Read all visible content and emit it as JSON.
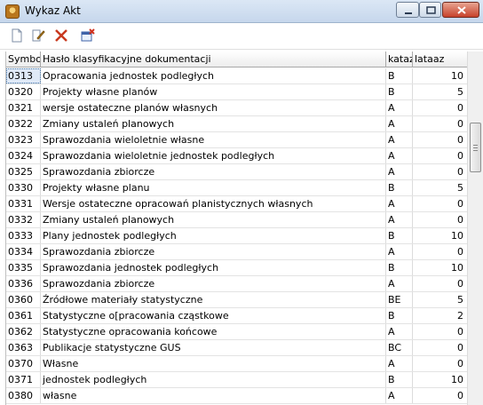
{
  "window": {
    "title": "Wykaz Akt"
  },
  "toolbar": {
    "buttons": [
      {
        "icon": "new-document-icon"
      },
      {
        "icon": "edit-document-icon"
      },
      {
        "icon": "delete-x-icon"
      },
      {
        "icon": "close-window-icon"
      }
    ]
  },
  "table": {
    "columns": {
      "symbol": "Symbol",
      "haslo": "Hasło klasyfikacyjne dokumentacji",
      "kataz": "kataz",
      "lataaz": "lataaz"
    },
    "rows": [
      {
        "symbol": "0313",
        "haslo": "Opracowania jednostek podległych",
        "kataz": "B",
        "lataaz": "10"
      },
      {
        "symbol": "0320",
        "haslo": "Projekty własne planów",
        "kataz": "B",
        "lataaz": "5"
      },
      {
        "symbol": "0321",
        "haslo": "wersje ostateczne planów własnych",
        "kataz": "A",
        "lataaz": "0"
      },
      {
        "symbol": "0322",
        "haslo": "Zmiany ustaleń planowych",
        "kataz": "A",
        "lataaz": "0"
      },
      {
        "symbol": "0323",
        "haslo": "Sprawozdania wieloletnie własne",
        "kataz": "A",
        "lataaz": "0"
      },
      {
        "symbol": "0324",
        "haslo": "Sprawozdania wieloletnie jednostek podległych",
        "kataz": "A",
        "lataaz": "0"
      },
      {
        "symbol": "0325",
        "haslo": "Sprawozdania zbiorcze",
        "kataz": "A",
        "lataaz": "0"
      },
      {
        "symbol": "0330",
        "haslo": "Projekty własne planu",
        "kataz": "B",
        "lataaz": "5"
      },
      {
        "symbol": "0331",
        "haslo": "Wersje ostateczne opracowań planistycznych własnych",
        "kataz": "A",
        "lataaz": "0"
      },
      {
        "symbol": "0332",
        "haslo": "Zmiany ustaleń planowych",
        "kataz": "A",
        "lataaz": "0"
      },
      {
        "symbol": "0333",
        "haslo": "Plany jednostek podległych",
        "kataz": "B",
        "lataaz": "10"
      },
      {
        "symbol": "0334",
        "haslo": "Sprawozdania zbiorcze",
        "kataz": "A",
        "lataaz": "0"
      },
      {
        "symbol": "0335",
        "haslo": "Sprawozdania jednostek podległych",
        "kataz": "B",
        "lataaz": "10"
      },
      {
        "symbol": "0336",
        "haslo": "Sprawozdania zbiorcze",
        "kataz": "A",
        "lataaz": "0"
      },
      {
        "symbol": "0360",
        "haslo": "Źródłowe materiały statystyczne",
        "kataz": "BE",
        "lataaz": "5"
      },
      {
        "symbol": "0361",
        "haslo": "Statystyczne o[pracowania cząstkowe",
        "kataz": "B",
        "lataaz": "2"
      },
      {
        "symbol": "0362",
        "haslo": "Statystyczne opracowania końcowe",
        "kataz": "A",
        "lataaz": "0"
      },
      {
        "symbol": "0363",
        "haslo": "Publikacje statystyczne GUS",
        "kataz": "BC",
        "lataaz": "0"
      },
      {
        "symbol": "0370",
        "haslo": " Własne",
        "kataz": "A",
        "lataaz": "0"
      },
      {
        "symbol": "0371",
        "haslo": "jednostek podległych",
        "kataz": "B",
        "lataaz": "10"
      },
      {
        "symbol": "0380",
        "haslo": "własne",
        "kataz": "A",
        "lataaz": "0"
      }
    ]
  }
}
